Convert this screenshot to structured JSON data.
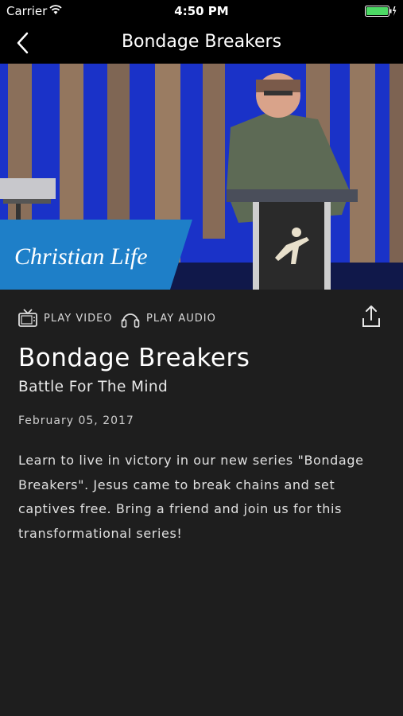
{
  "status_bar": {
    "carrier": "Carrier",
    "time": "4:50 PM"
  },
  "nav": {
    "title": "Bondage Breakers",
    "back_icon": "chevron-left-icon"
  },
  "hero": {
    "brand_text": "Christian Life",
    "brand_color": "#1e7fc8"
  },
  "actions": {
    "play_video": "PLAY VIDEO",
    "play_audio": "PLAY AUDIO",
    "share_icon": "share-icon"
  },
  "sermon": {
    "title": "Bondage Breakers",
    "subtitle": "Battle For The Mind",
    "date": "February 05, 2017",
    "description": "Learn to live in victory in our new series \"Bondage Breakers\". Jesus came to break chains and set captives free. Bring a friend and join us for this transformational series!"
  },
  "colors": {
    "background": "#1e1e1e",
    "bar": "#000000",
    "battery": "#4cd964"
  }
}
